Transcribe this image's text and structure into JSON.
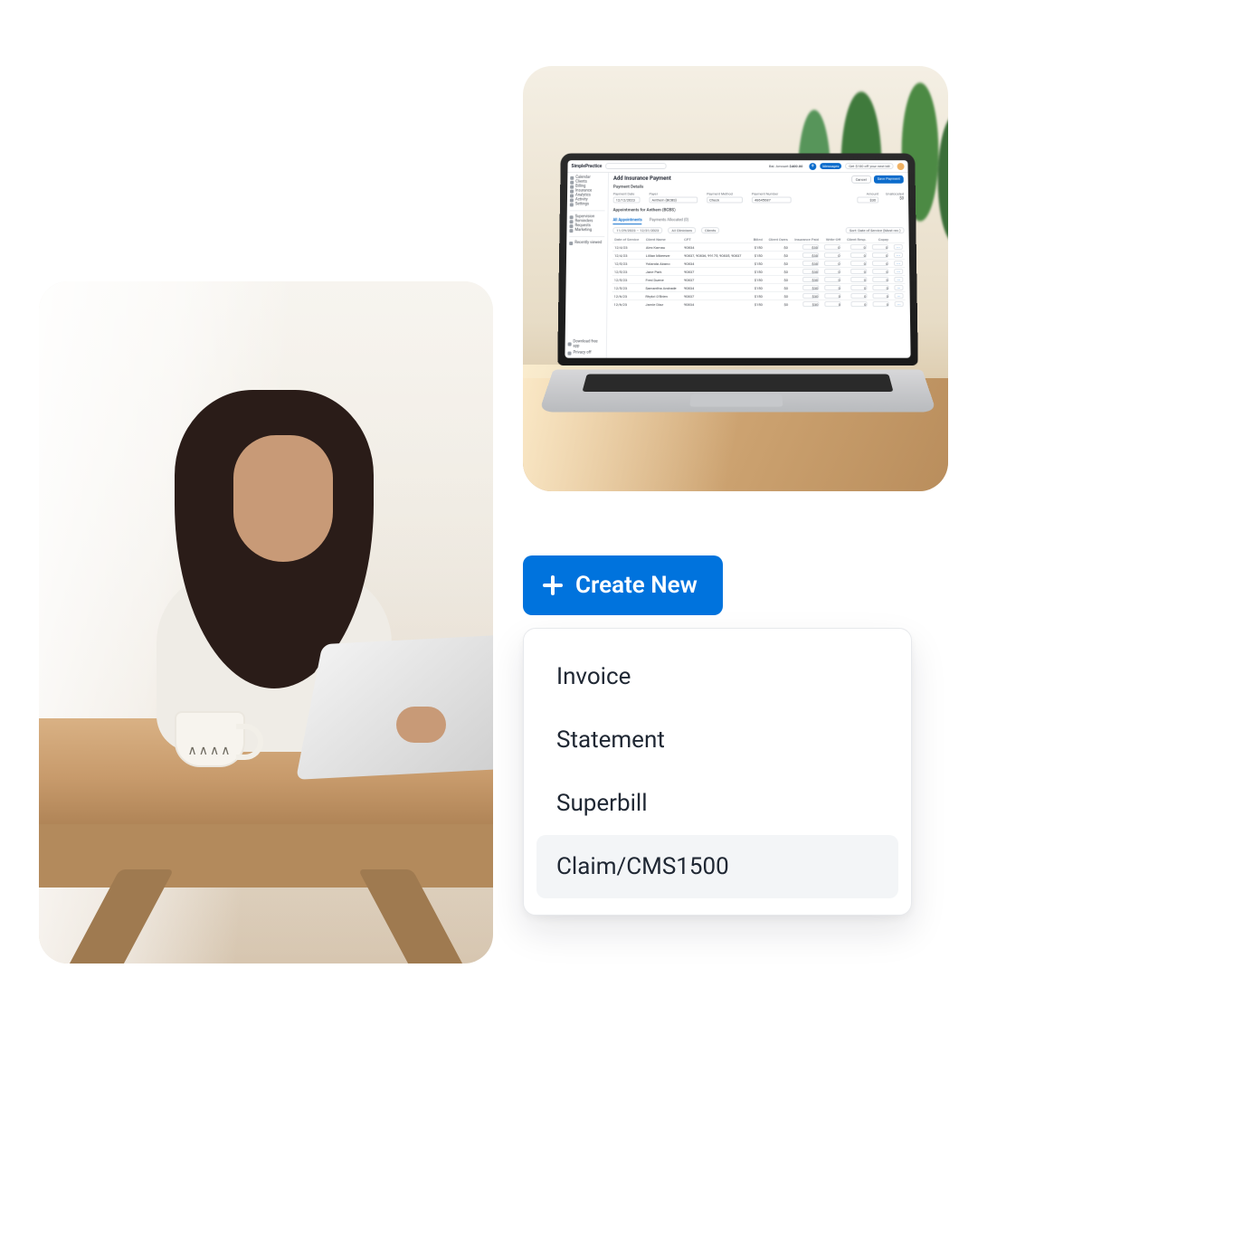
{
  "laptop_app": {
    "brand": "SimplePractice",
    "top": {
      "balance_label": "Bal. Amount",
      "balance": "$400.00",
      "messages": "Messages",
      "promo": "Get $100 off your next bill"
    },
    "sidebar": {
      "items": [
        "Calendar",
        "Clients",
        "Billing",
        "Insurance",
        "Analytics",
        "Activity",
        "Settings"
      ],
      "items2": [
        "Supervision",
        "Reminders",
        "Requests",
        "Marketing"
      ],
      "recent": "Recently viewed",
      "download": "Download free app",
      "privacy": "Privacy off"
    },
    "page": {
      "title": "Add Insurance Payment",
      "cancel": "Cancel",
      "save": "Save Payment",
      "section": "Payment Details",
      "fields": {
        "date_lbl": "Payment Date",
        "date_val": "12/12/2023",
        "payer_lbl": "Payer",
        "payer_val": "Anthem (BCBS)",
        "method_lbl": "Payment Method",
        "method_val": "Check",
        "num_lbl": "Payment Number",
        "num_val": "48645687",
        "amount_lbl": "Amount",
        "amount_val": "$30",
        "unalloc_lbl": "Unallocated",
        "unalloc_val": "$0"
      },
      "appts_title": "Appointments for Anthem (BCBS)",
      "tabs": {
        "all": "All Appointments",
        "alloc": "Payments Allocated (0)"
      },
      "filters": {
        "range": "11/29/2023 – 12/31/2023",
        "clin": "All Clinicians",
        "clients": "Clients",
        "sort": "Sort: Date of Service (Most rec.)"
      },
      "cols": {
        "dos": "Date of Service",
        "client": "Client Name",
        "cpt": "CPT",
        "billed": "Billed",
        "clientowes": "Client Owes",
        "inspaid": "Insurance Paid",
        "wo": "Write-Off",
        "cresp": "Client Resp.",
        "copay": "Copay"
      },
      "rows": [
        {
          "dos": "12/4/23",
          "client": "Alex Kamau",
          "cpt": "90834",
          "billed": "$150",
          "owes": "$0"
        },
        {
          "dos": "12/4/23",
          "client": "Lillian Mbeeser",
          "cpt": "90837, 90836, 99175, 90835, 90837",
          "billed": "$150",
          "owes": "$0"
        },
        {
          "dos": "12/5/23",
          "client": "Yolanda Abano",
          "cpt": "90834",
          "billed": "$150",
          "owes": "$0"
        },
        {
          "dos": "12/5/23",
          "client": "Jane Park",
          "cpt": "90837",
          "billed": "$150",
          "owes": "$0"
        },
        {
          "dos": "12/5/23",
          "client": "Fred Duene",
          "cpt": "90837",
          "billed": "$150",
          "owes": "$0"
        },
        {
          "dos": "12/5/23",
          "client": "Samantha Andrade",
          "cpt": "90834",
          "billed": "$150",
          "owes": "$0"
        },
        {
          "dos": "12/6/23",
          "client": "Rhykri O'Brien",
          "cpt": "90837",
          "billed": "$150",
          "owes": "$0"
        },
        {
          "dos": "12/6/23",
          "client": "Jamie Diaz",
          "cpt": "90834",
          "billed": "$150",
          "owes": "$0"
        }
      ],
      "default_inspaid": "$30",
      "default_small": "0"
    }
  },
  "create": {
    "button": "Create New",
    "items": [
      "Invoice",
      "Statement",
      "Superbill",
      "Claim/CMS1500"
    ],
    "hover_index": 3
  }
}
